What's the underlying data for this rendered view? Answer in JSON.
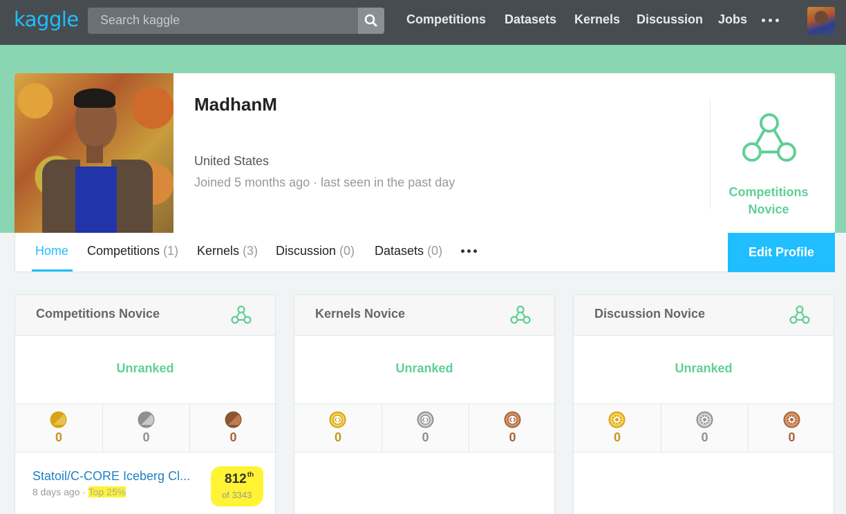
{
  "nav": {
    "logo": "kaggle",
    "search_placeholder": "Search kaggle",
    "links": [
      "Competitions",
      "Datasets",
      "Kernels",
      "Discussion",
      "Jobs"
    ],
    "more_icon": "ellipsis-icon",
    "search_icon": "search-icon"
  },
  "profile": {
    "name": "MadhanM",
    "location": "United States",
    "joined": "Joined 5 months ago · last seen in the past day",
    "tier": {
      "line1": "Competitions",
      "line2": "Novice"
    }
  },
  "tabs": [
    {
      "label": "Home",
      "count": ""
    },
    {
      "label": "Competitions",
      "count": "(1)"
    },
    {
      "label": "Kernels",
      "count": "(3)"
    },
    {
      "label": "Discussion",
      "count": "(0)"
    },
    {
      "label": "Datasets",
      "count": "(0)"
    }
  ],
  "edit_profile": "Edit Profile",
  "cards": [
    {
      "title": "Competitions Novice",
      "rank": "Unranked",
      "medals": {
        "gold": "0",
        "silver": "0",
        "bronze": "0"
      }
    },
    {
      "title": "Kernels Novice",
      "rank": "Unranked",
      "medals": {
        "gold": "0",
        "silver": "0",
        "bronze": "0"
      }
    },
    {
      "title": "Discussion Novice",
      "rank": "Unranked",
      "medals": {
        "gold": "0",
        "silver": "0",
        "bronze": "0"
      }
    }
  ],
  "competition": {
    "name": "Statoil/C-CORE Iceberg Cl...",
    "time": "8 days ago",
    "separator": " · ",
    "top": "Top 25%",
    "rank": "812",
    "rank_suffix": "th",
    "of_total": "of 3343"
  },
  "colors": {
    "accent": "#20beff",
    "novice_green": "#5fcf96",
    "band_green": "#8bd6b2",
    "nav_bg": "#474c50",
    "gold": "#d6a414",
    "silver": "#8f8f8f",
    "bronze": "#a5653a",
    "highlight": "#fff334"
  }
}
